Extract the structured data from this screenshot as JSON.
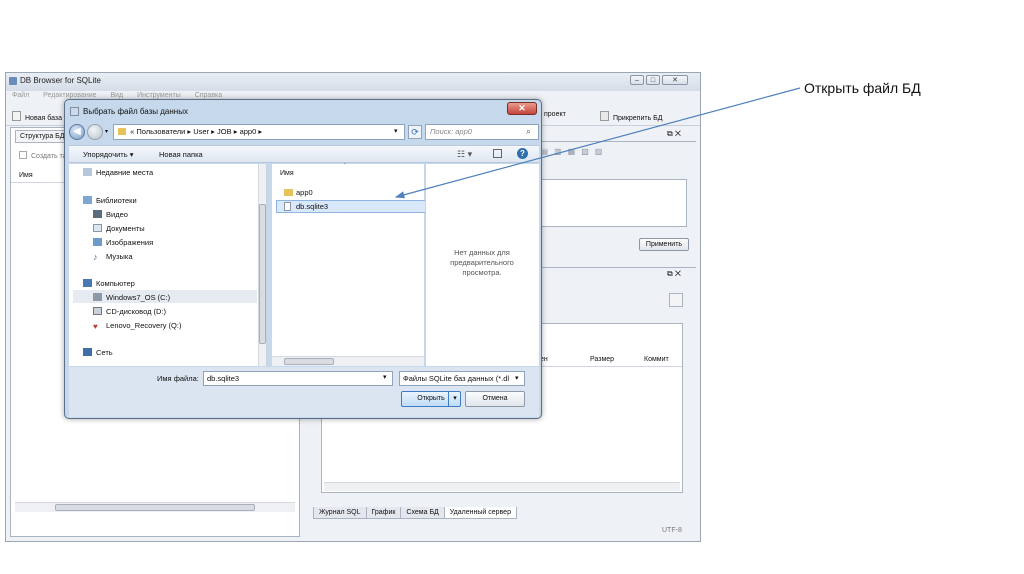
{
  "app": {
    "title": "DB Browser for SQLite",
    "menu": [
      "Файл",
      "Редактирование",
      "Вид",
      "Инструменты",
      "Справка"
    ],
    "toolbar": {
      "new_db": "Новая база",
      "project": "проект",
      "attach": "Прикрепить БД"
    },
    "left_panel": {
      "tab": "Структура БД",
      "create_btn": "Создать та",
      "col_name": "Имя"
    },
    "right_panel": {
      "apply_btn": "Применить",
      "columns": [
        "ен",
        "Размер",
        "Коммит"
      ],
      "bottom_tabs": [
        "Журнал SQL",
        "График",
        "Схема БД",
        "Удаленный сервер"
      ],
      "encoding": "UTF-8"
    }
  },
  "dialog": {
    "title": "Выбрать файл базы данных",
    "breadcrumb": [
      "«",
      "Пользователи",
      "User",
      "JOB",
      "app0"
    ],
    "search_placeholder": "Поиск: app0",
    "cmd_organize": "Упорядочить",
    "cmd_new_folder": "Новая папка",
    "nav": {
      "recent": "Недавние места",
      "libraries": "Библиотеки",
      "video": "Видео",
      "documents": "Документы",
      "images": "Изображения",
      "music": "Музыка",
      "computer": "Компьютер",
      "drive_c": "Windows7_OS (C:)",
      "drive_d": "CD-дисковод (D:)",
      "drive_q": "Lenovo_Recovery (Q:)",
      "network": "Сеть"
    },
    "file_col_name": "Имя",
    "files": [
      "app0",
      "db.sqlite3"
    ],
    "preview_text": "Нет данных для предварительного просмотра.",
    "filename_label": "Имя файла:",
    "filename_value": "db.sqlite3",
    "filter_value": "Файлы SQLite баз данных (*.dl",
    "open_btn": "Открыть",
    "cancel_btn": "Отмена"
  },
  "annotation": "Открыть файл БД",
  "colors": {
    "arrow": "#4f81bd",
    "selected_row": "#d9e8fb"
  }
}
